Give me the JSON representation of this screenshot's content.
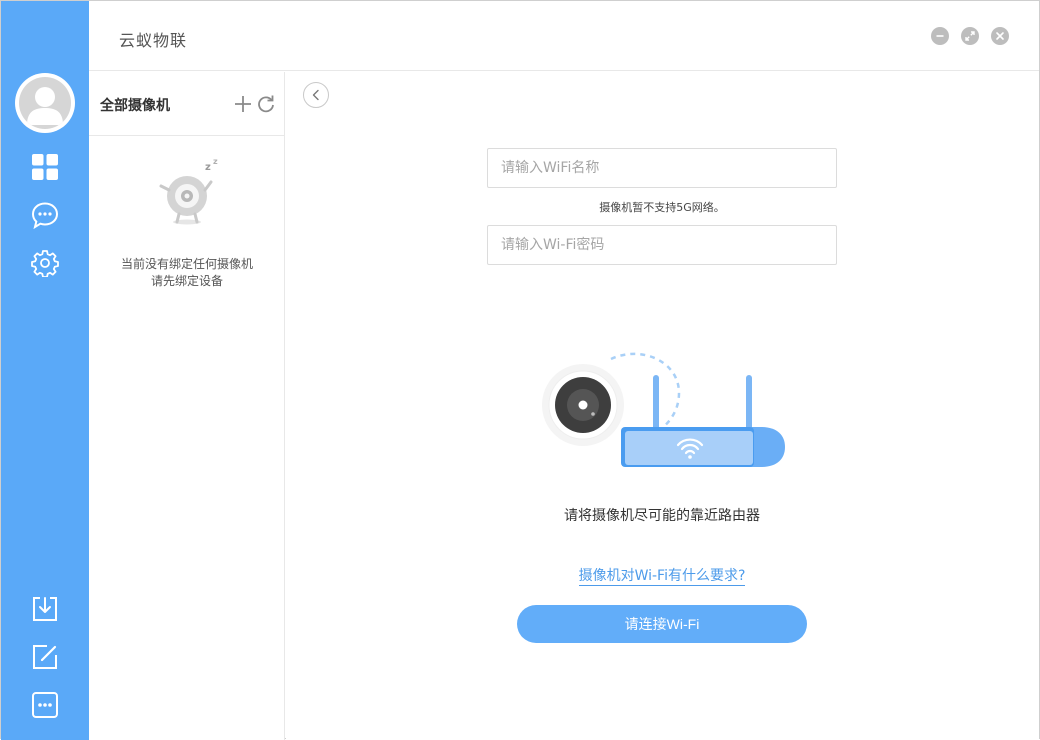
{
  "app": {
    "title": "云蚁物联"
  },
  "window_controls": [
    "minimize",
    "restore",
    "close"
  ],
  "sidebar": {
    "top_icons": [
      "grid-icon",
      "chat-icon",
      "gear-icon"
    ],
    "bottom_icons": [
      "download-icon",
      "edit-icon",
      "more-icon"
    ],
    "accent_color": "#5aa9f8"
  },
  "camera_panel": {
    "title": "全部摄像机",
    "empty_line1": "当前没有绑定任何摄像机",
    "empty_line2": "请先绑定设备"
  },
  "wifi_form": {
    "ssid_placeholder": "请输入WiFi名称",
    "note": "摄像机暂不支持5G网络。",
    "password_placeholder": "请输入Wi-Fi密码",
    "tip": "请将摄像机尽可能的靠近路由器",
    "requirements_link": "摄像机对Wi-Fi有什么要求?",
    "connect_label": "请连接Wi-Fi"
  }
}
